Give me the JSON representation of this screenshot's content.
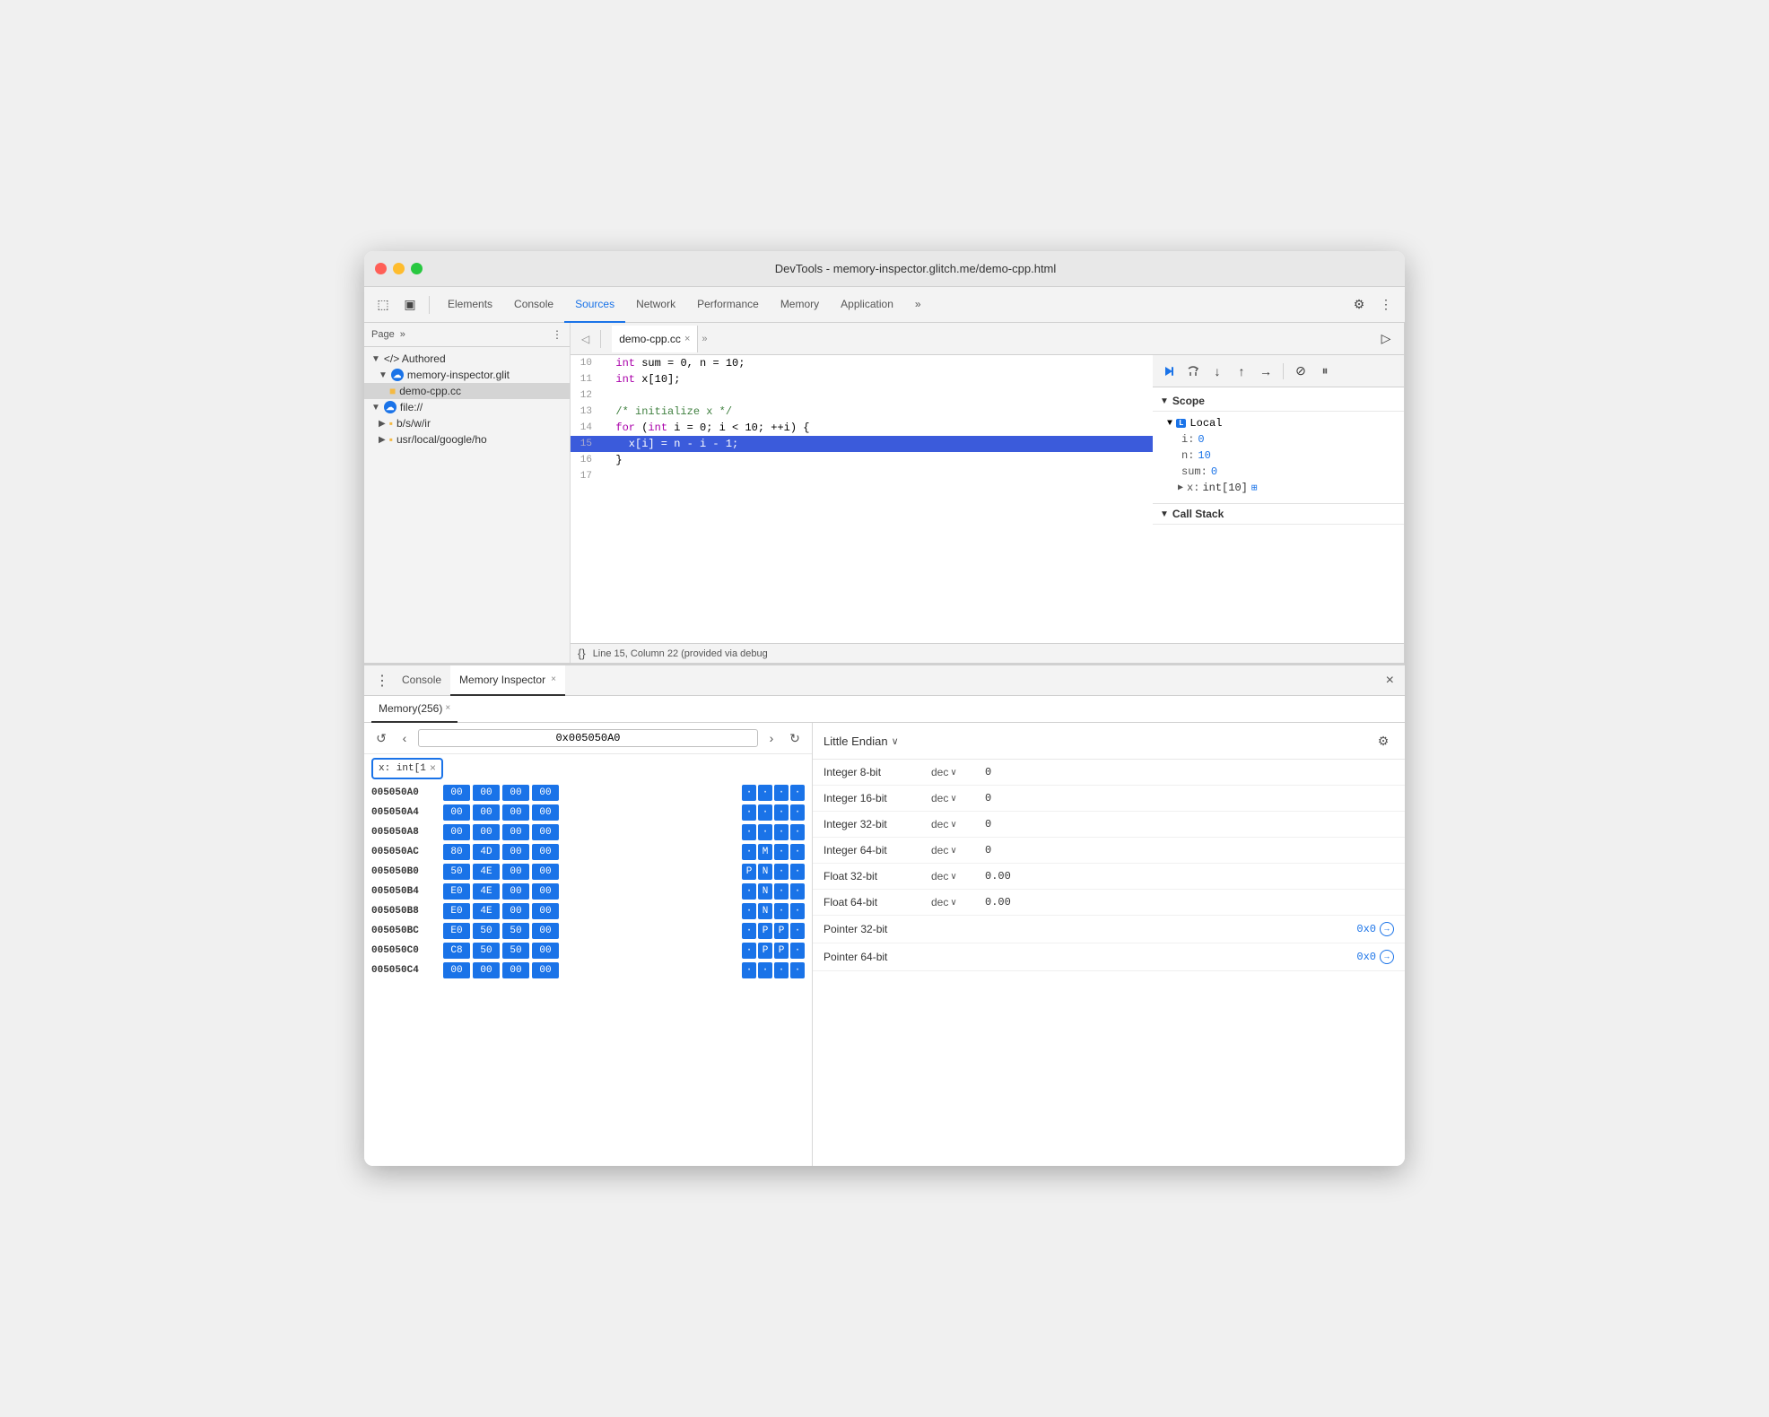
{
  "window": {
    "title": "DevTools - memory-inspector.glitch.me/demo-cpp.html"
  },
  "titlebar": {
    "close_label": "",
    "min_label": "",
    "max_label": "",
    "title": "DevTools - memory-inspector.glitch.me/demo-cpp.html"
  },
  "toolbar": {
    "tabs": [
      {
        "id": "elements",
        "label": "Elements",
        "active": false
      },
      {
        "id": "console",
        "label": "Console",
        "active": false
      },
      {
        "id": "sources",
        "label": "Sources",
        "active": true
      },
      {
        "id": "network",
        "label": "Network",
        "active": false
      },
      {
        "id": "performance",
        "label": "Performance",
        "active": false
      },
      {
        "id": "memory",
        "label": "Memory",
        "active": false
      },
      {
        "id": "application",
        "label": "Application",
        "active": false
      }
    ],
    "more_label": "»",
    "settings_icon": "⚙",
    "menu_icon": "⋮"
  },
  "sidebar": {
    "header_label": "Page",
    "more": "»",
    "menu_icon": "⋮",
    "items": [
      {
        "id": "authored",
        "label": "</> Authored",
        "indent": 0,
        "type": "group",
        "expanded": true
      },
      {
        "id": "memory-inspector-glitch",
        "label": "memory-inspector.glit",
        "indent": 1,
        "type": "cloud",
        "expanded": true
      },
      {
        "id": "demo-cpp-cc",
        "label": "demo-cpp.cc",
        "indent": 2,
        "type": "file",
        "selected": true
      },
      {
        "id": "file",
        "label": "file://",
        "indent": 0,
        "type": "cloud",
        "expanded": true
      },
      {
        "id": "bsw",
        "label": "b/s/w/ir",
        "indent": 1,
        "type": "folder",
        "expanded": false
      },
      {
        "id": "usr-local",
        "label": "usr/local/google/ho",
        "indent": 1,
        "type": "folder",
        "expanded": false
      }
    ]
  },
  "file_tabs": [
    {
      "label": "demo-cpp.cc",
      "active": true,
      "closeable": true
    },
    {
      "label": "»",
      "active": false,
      "closeable": false
    }
  ],
  "code": {
    "lines": [
      {
        "num": 10,
        "text": "  int sum = 0, n = 10;",
        "highlighted": false
      },
      {
        "num": 11,
        "text": "  int x[10];",
        "highlighted": false
      },
      {
        "num": 12,
        "text": "",
        "highlighted": false
      },
      {
        "num": 13,
        "text": "  /* initialize x */",
        "highlighted": false
      },
      {
        "num": 14,
        "text": "  for (int i = 0; i < 10; ++i) {",
        "highlighted": false
      },
      {
        "num": 15,
        "text": "    x[i] = n - i - 1;",
        "highlighted": true
      },
      {
        "num": 16,
        "text": "  }",
        "highlighted": false
      },
      {
        "num": 17,
        "text": "",
        "highlighted": false
      }
    ],
    "status": "Line 15, Column 22 (provided via debug"
  },
  "scope": {
    "title": "Scope",
    "local_section": {
      "label": "Local",
      "expanded": true,
      "items": [
        {
          "key": "i:",
          "value": "0"
        },
        {
          "key": "n:",
          "value": "10"
        },
        {
          "key": "sum:",
          "value": "0"
        }
      ],
      "complex_item": {
        "key": "x:",
        "type": "int[10]",
        "has_memory_icon": true
      }
    },
    "call_stack": {
      "label": "Call Stack"
    }
  },
  "debug_toolbar": {
    "buttons": [
      {
        "id": "resume",
        "icon": "▶",
        "active": true,
        "title": "Resume"
      },
      {
        "id": "step-over",
        "icon": "↺",
        "title": "Step over"
      },
      {
        "id": "step-into",
        "icon": "↓",
        "title": "Step into"
      },
      {
        "id": "step-out",
        "icon": "↑",
        "title": "Step out"
      },
      {
        "id": "step",
        "icon": "→",
        "title": "Step"
      },
      {
        "id": "deactivate",
        "icon": "⊘",
        "title": "Deactivate"
      },
      {
        "id": "pause",
        "icon": "⏸",
        "title": "Pause on exceptions"
      }
    ]
  },
  "bottom_panel": {
    "tabs": [
      {
        "id": "console",
        "label": "Console",
        "active": false
      },
      {
        "id": "memory-inspector",
        "label": "Memory Inspector",
        "active": true,
        "closeable": true
      }
    ],
    "memory_subtab": {
      "label": "Memory(256)",
      "closeable": true
    }
  },
  "memory_inspector": {
    "address_bar": {
      "back_disabled": false,
      "forward_disabled": false,
      "prev": "‹",
      "next": "›",
      "address": "0x005050A0",
      "refresh": "↻"
    },
    "expression_chip": {
      "label": "x: int[1",
      "close": "×"
    },
    "hex_rows": [
      {
        "addr": "005050A0",
        "bold": true,
        "bytes": [
          "00",
          "00",
          "00",
          "00"
        ],
        "dots": [
          "·",
          "·",
          "·",
          "·"
        ],
        "selected": [
          true,
          true,
          true,
          true
        ]
      },
      {
        "addr": "005050A4",
        "bytes": [
          "00",
          "00",
          "00",
          "00"
        ],
        "dots": [
          "·",
          "·",
          "·",
          "·"
        ],
        "selected": [
          true,
          true,
          true,
          true
        ]
      },
      {
        "addr": "005050A8",
        "bytes": [
          "00",
          "00",
          "00",
          "00"
        ],
        "dots": [
          "·",
          "·",
          "·",
          "·"
        ],
        "selected": [
          true,
          true,
          true,
          true
        ]
      },
      {
        "addr": "005050AC",
        "bytes": [
          "80",
          "4D",
          "00",
          "00"
        ],
        "dots": [
          "·",
          "M",
          "·",
          "·"
        ],
        "selected": [
          true,
          true,
          true,
          true
        ]
      },
      {
        "addr": "005050B0",
        "bytes": [
          "50",
          "4E",
          "00",
          "00"
        ],
        "dots": [
          "P",
          "N",
          "·",
          "·"
        ],
        "selected": [
          true,
          true,
          true,
          true
        ]
      },
      {
        "addr": "005050B4",
        "bytes": [
          "E0",
          "4E",
          "00",
          "00"
        ],
        "dots": [
          "·",
          "N",
          "·",
          "·"
        ],
        "selected": [
          true,
          true,
          true,
          true
        ]
      },
      {
        "addr": "005050B8",
        "bytes": [
          "E0",
          "4E",
          "00",
          "00"
        ],
        "dots": [
          "·",
          "N",
          "·",
          "·"
        ],
        "selected": [
          true,
          true,
          true,
          true
        ]
      },
      {
        "addr": "005050BC",
        "bytes": [
          "E0",
          "50",
          "50",
          "00"
        ],
        "dots": [
          "·",
          "P",
          "P",
          "·"
        ],
        "selected": [
          true,
          true,
          true,
          true
        ]
      },
      {
        "addr": "005050C0",
        "bytes": [
          "C8",
          "50",
          "50",
          "00"
        ],
        "dots": [
          "·",
          "P",
          "P",
          "·"
        ],
        "selected": [
          true,
          true,
          true,
          true
        ]
      },
      {
        "addr": "005050C4",
        "bytes": [
          "00",
          "00",
          "00",
          "00"
        ],
        "dots": [
          "·",
          "·",
          "·",
          "·"
        ],
        "selected": [
          true,
          true,
          true,
          true
        ]
      }
    ],
    "inspector": {
      "endian": "Little Endian",
      "rows": [
        {
          "type": "Integer 8-bit",
          "format": "dec",
          "value": "0",
          "is_link": false
        },
        {
          "type": "Integer 16-bit",
          "format": "dec",
          "value": "0",
          "is_link": false
        },
        {
          "type": "Integer 32-bit",
          "format": "dec",
          "value": "0",
          "is_link": false
        },
        {
          "type": "Integer 64-bit",
          "format": "dec",
          "value": "0",
          "is_link": false
        },
        {
          "type": "Float 32-bit",
          "format": "dec",
          "value": "0.00",
          "is_link": false
        },
        {
          "type": "Float 64-bit",
          "format": "dec",
          "value": "0.00",
          "is_link": false
        },
        {
          "type": "Pointer 32-bit",
          "format": "",
          "value": "0x0",
          "is_link": true
        },
        {
          "type": "Pointer 64-bit",
          "format": "",
          "value": "0x0",
          "is_link": true
        }
      ]
    }
  }
}
